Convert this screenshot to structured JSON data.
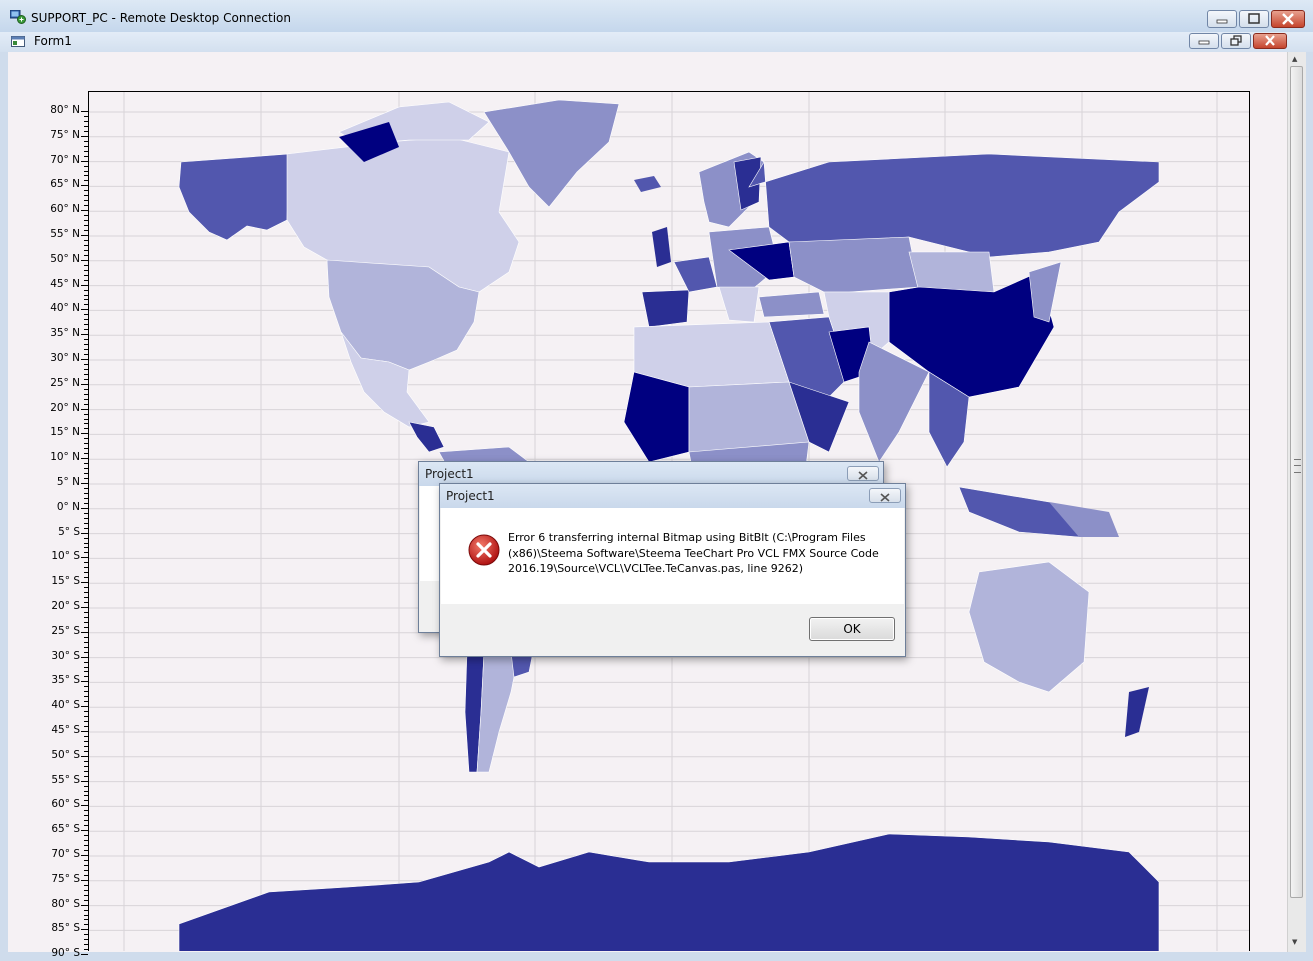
{
  "window": {
    "title": "SUPPORT_PC - Remote Desktop Connection"
  },
  "form": {
    "title": "Form1"
  },
  "chart_data": {
    "type": "map",
    "ylabels": [
      "80° N",
      "75° N",
      "70° N",
      "65° N",
      "60° N",
      "55° N",
      "50° N",
      "45° N",
      "40° N",
      "35° N",
      "30° N",
      "25° N",
      "20° N",
      "15° N",
      "10° N",
      "5° N",
      "0° N",
      "5° S",
      "10° S",
      "15° S",
      "20° S",
      "25° S",
      "30° S",
      "35° S",
      "40° S",
      "45° S",
      "50° S",
      "55° S",
      "60° S",
      "65° S",
      "70° S",
      "75° S",
      "80° S",
      "85° S",
      "90° S"
    ],
    "yvalues": [
      80,
      75,
      70,
      65,
      60,
      55,
      50,
      45,
      40,
      35,
      30,
      25,
      20,
      15,
      10,
      5,
      0,
      -5,
      -10,
      -15,
      -20,
      -25,
      -30,
      -35,
      -40,
      -45,
      -50,
      -55,
      -60,
      -65,
      -70,
      -75,
      -80,
      -85,
      -90
    ],
    "grid": true,
    "palette": [
      "#2a2e93",
      "#000080",
      "#5257ae",
      "#8c90c8",
      "#b1b4da",
      "#cfd0e9",
      "#e7e7f3",
      "#ffffff"
    ]
  },
  "dialog_back": {
    "title": "Project1"
  },
  "dialog_front": {
    "title": "Project1",
    "message": "Error 6 transferring internal Bitmap using BitBlt (C:\\Program Files (x86)\\Steema Software\\Steema TeeChart Pro VCL FMX Source Code 2016.19\\Source\\VCL\\VCLTee.TeCanvas.pas, line 9262)",
    "ok_label": "OK"
  }
}
